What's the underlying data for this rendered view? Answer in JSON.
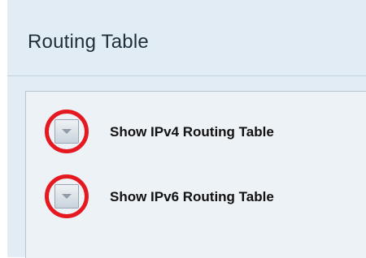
{
  "page": {
    "title": "Routing Table"
  },
  "routing_sections": [
    {
      "label": "Show IPv4 Routing Table",
      "toggle_icon": "chevron-down-icon",
      "highlighted": true
    },
    {
      "label": "Show IPv6 Routing Table",
      "toggle_icon": "chevron-down-icon",
      "highlighted": true
    }
  ],
  "colors": {
    "background": "#e2ecf5",
    "panel": "#edf2f7",
    "highlight": "#e51920",
    "text": "#111111"
  }
}
